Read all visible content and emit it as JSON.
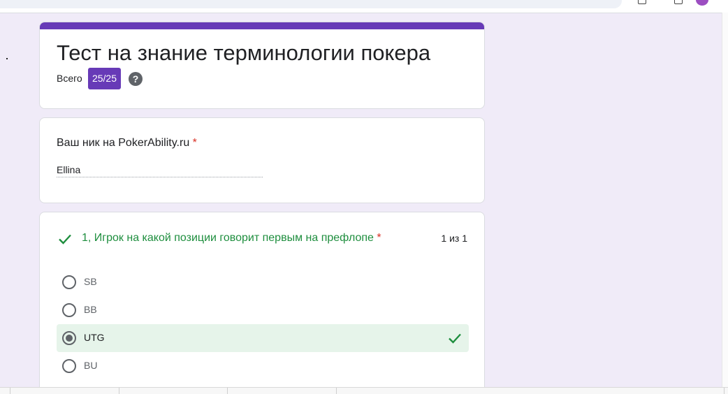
{
  "form": {
    "title": "Тест на знание терминологии покера",
    "score_label": "Всего",
    "score_value": "25/25",
    "help_glyph": "?",
    "accent_color": "#673ab7"
  },
  "nickname_field": {
    "label": "Ваш ник на PokerAbility.ru",
    "required_mark": "*",
    "value": "Ellina"
  },
  "question_1": {
    "title": "1, Игрок на какой позиции говорит первым на префлопе",
    "required_mark": "*",
    "points": "1 из 1",
    "status_icon": "check-icon",
    "status_color": "#1e8e3e",
    "options": [
      {
        "label": "SB",
        "selected": false,
        "correct": false
      },
      {
        "label": "BB",
        "selected": false,
        "correct": false
      },
      {
        "label": "UTG",
        "selected": true,
        "correct": true
      },
      {
        "label": "BU",
        "selected": false,
        "correct": false
      }
    ]
  }
}
